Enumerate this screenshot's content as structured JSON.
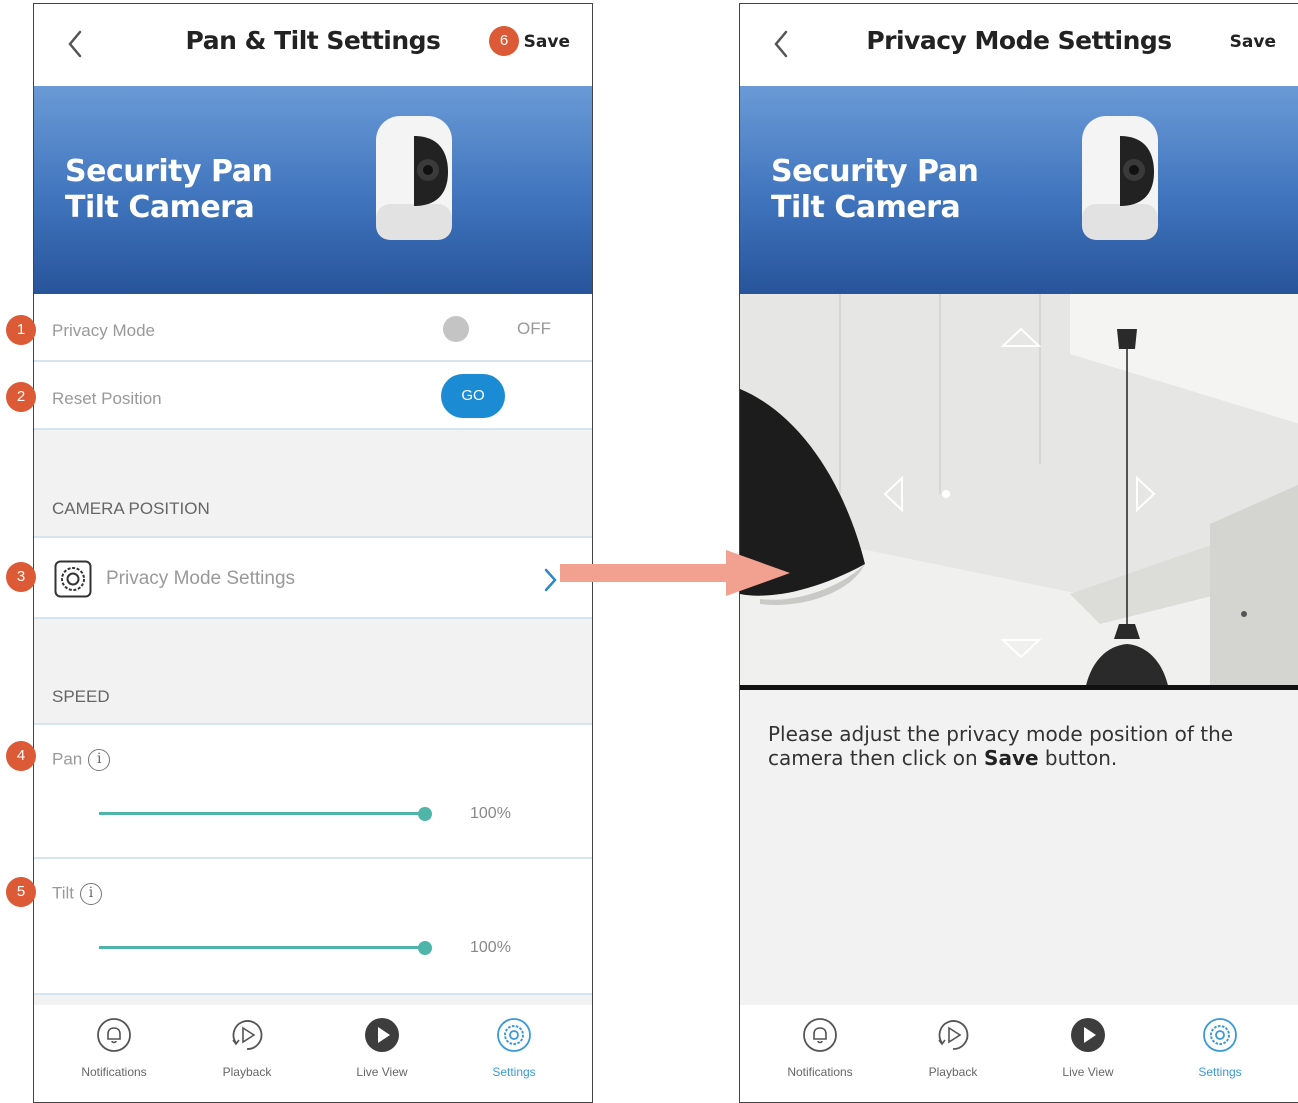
{
  "left_screen": {
    "header": {
      "title": "Pan & Tilt Settings",
      "save_label": "Save"
    },
    "banner": {
      "title": "Security Pan\nTilt Camera"
    },
    "privacy_mode": {
      "label": "Privacy Mode",
      "state": "OFF"
    },
    "reset_position": {
      "label": "Reset Position",
      "button": "GO"
    },
    "camera_position": {
      "section": "CAMERA POSITION",
      "item": "Privacy Mode Settings"
    },
    "speed": {
      "section": "SPEED",
      "pan": {
        "label": "Pan",
        "value": "100%",
        "fraction": 1.0
      },
      "tilt": {
        "label": "Tilt",
        "value": "100%",
        "fraction": 1.0
      }
    },
    "nav": [
      {
        "label": "Notifications",
        "icon": "bell-icon"
      },
      {
        "label": "Playback",
        "icon": "playback-icon"
      },
      {
        "label": "Live View",
        "icon": "play-icon"
      },
      {
        "label": "Settings",
        "icon": "gear-icon",
        "active": true
      }
    ]
  },
  "right_screen": {
    "header": {
      "title": "Privacy Mode Settings",
      "save_label": "Save"
    },
    "banner": {
      "title": "Security Pan\nTilt Camera"
    },
    "instruction": {
      "part1": "Please adjust the privacy mode position of the camera then click on ",
      "bold": "Save",
      "part2": " button."
    },
    "nav": [
      {
        "label": "Notifications",
        "icon": "bell-icon"
      },
      {
        "label": "Playback",
        "icon": "playback-icon"
      },
      {
        "label": "Live View",
        "icon": "play-icon"
      },
      {
        "label": "Settings",
        "icon": "gear-icon",
        "active": true
      }
    ]
  },
  "callouts": [
    "1",
    "2",
    "3",
    "4",
    "5",
    "6"
  ],
  "colors": {
    "accent": "#1b8bd3",
    "slider": "#4fb5a8",
    "badge": "#dc5a36",
    "arrow": "#f2a090",
    "banner_top": "#6a9ad6",
    "banner_bottom": "#27549a"
  }
}
